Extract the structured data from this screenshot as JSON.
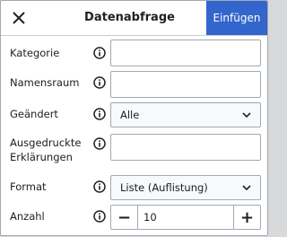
{
  "dialog": {
    "title": "Datenabfrage",
    "primary_action": "Einfügen",
    "close_icon": "close-icon"
  },
  "fields": {
    "kategorie": {
      "label": "Kategorie",
      "value": ""
    },
    "namensraum": {
      "label": "Namensraum",
      "value": ""
    },
    "geaendert": {
      "label": "Geändert",
      "selected": "Alle"
    },
    "ausgedruckte": {
      "label_line1": "Ausgedruckte",
      "label_line2": "Erklärungen",
      "value": ""
    },
    "format": {
      "label": "Format",
      "selected": "Liste (Auflistung)"
    },
    "anzahl": {
      "label": "Anzahl",
      "value": "10",
      "minus": "−",
      "plus": "+"
    }
  },
  "colors": {
    "primary": "#3366cc",
    "border": "#a2a9b1",
    "text": "#202122"
  }
}
